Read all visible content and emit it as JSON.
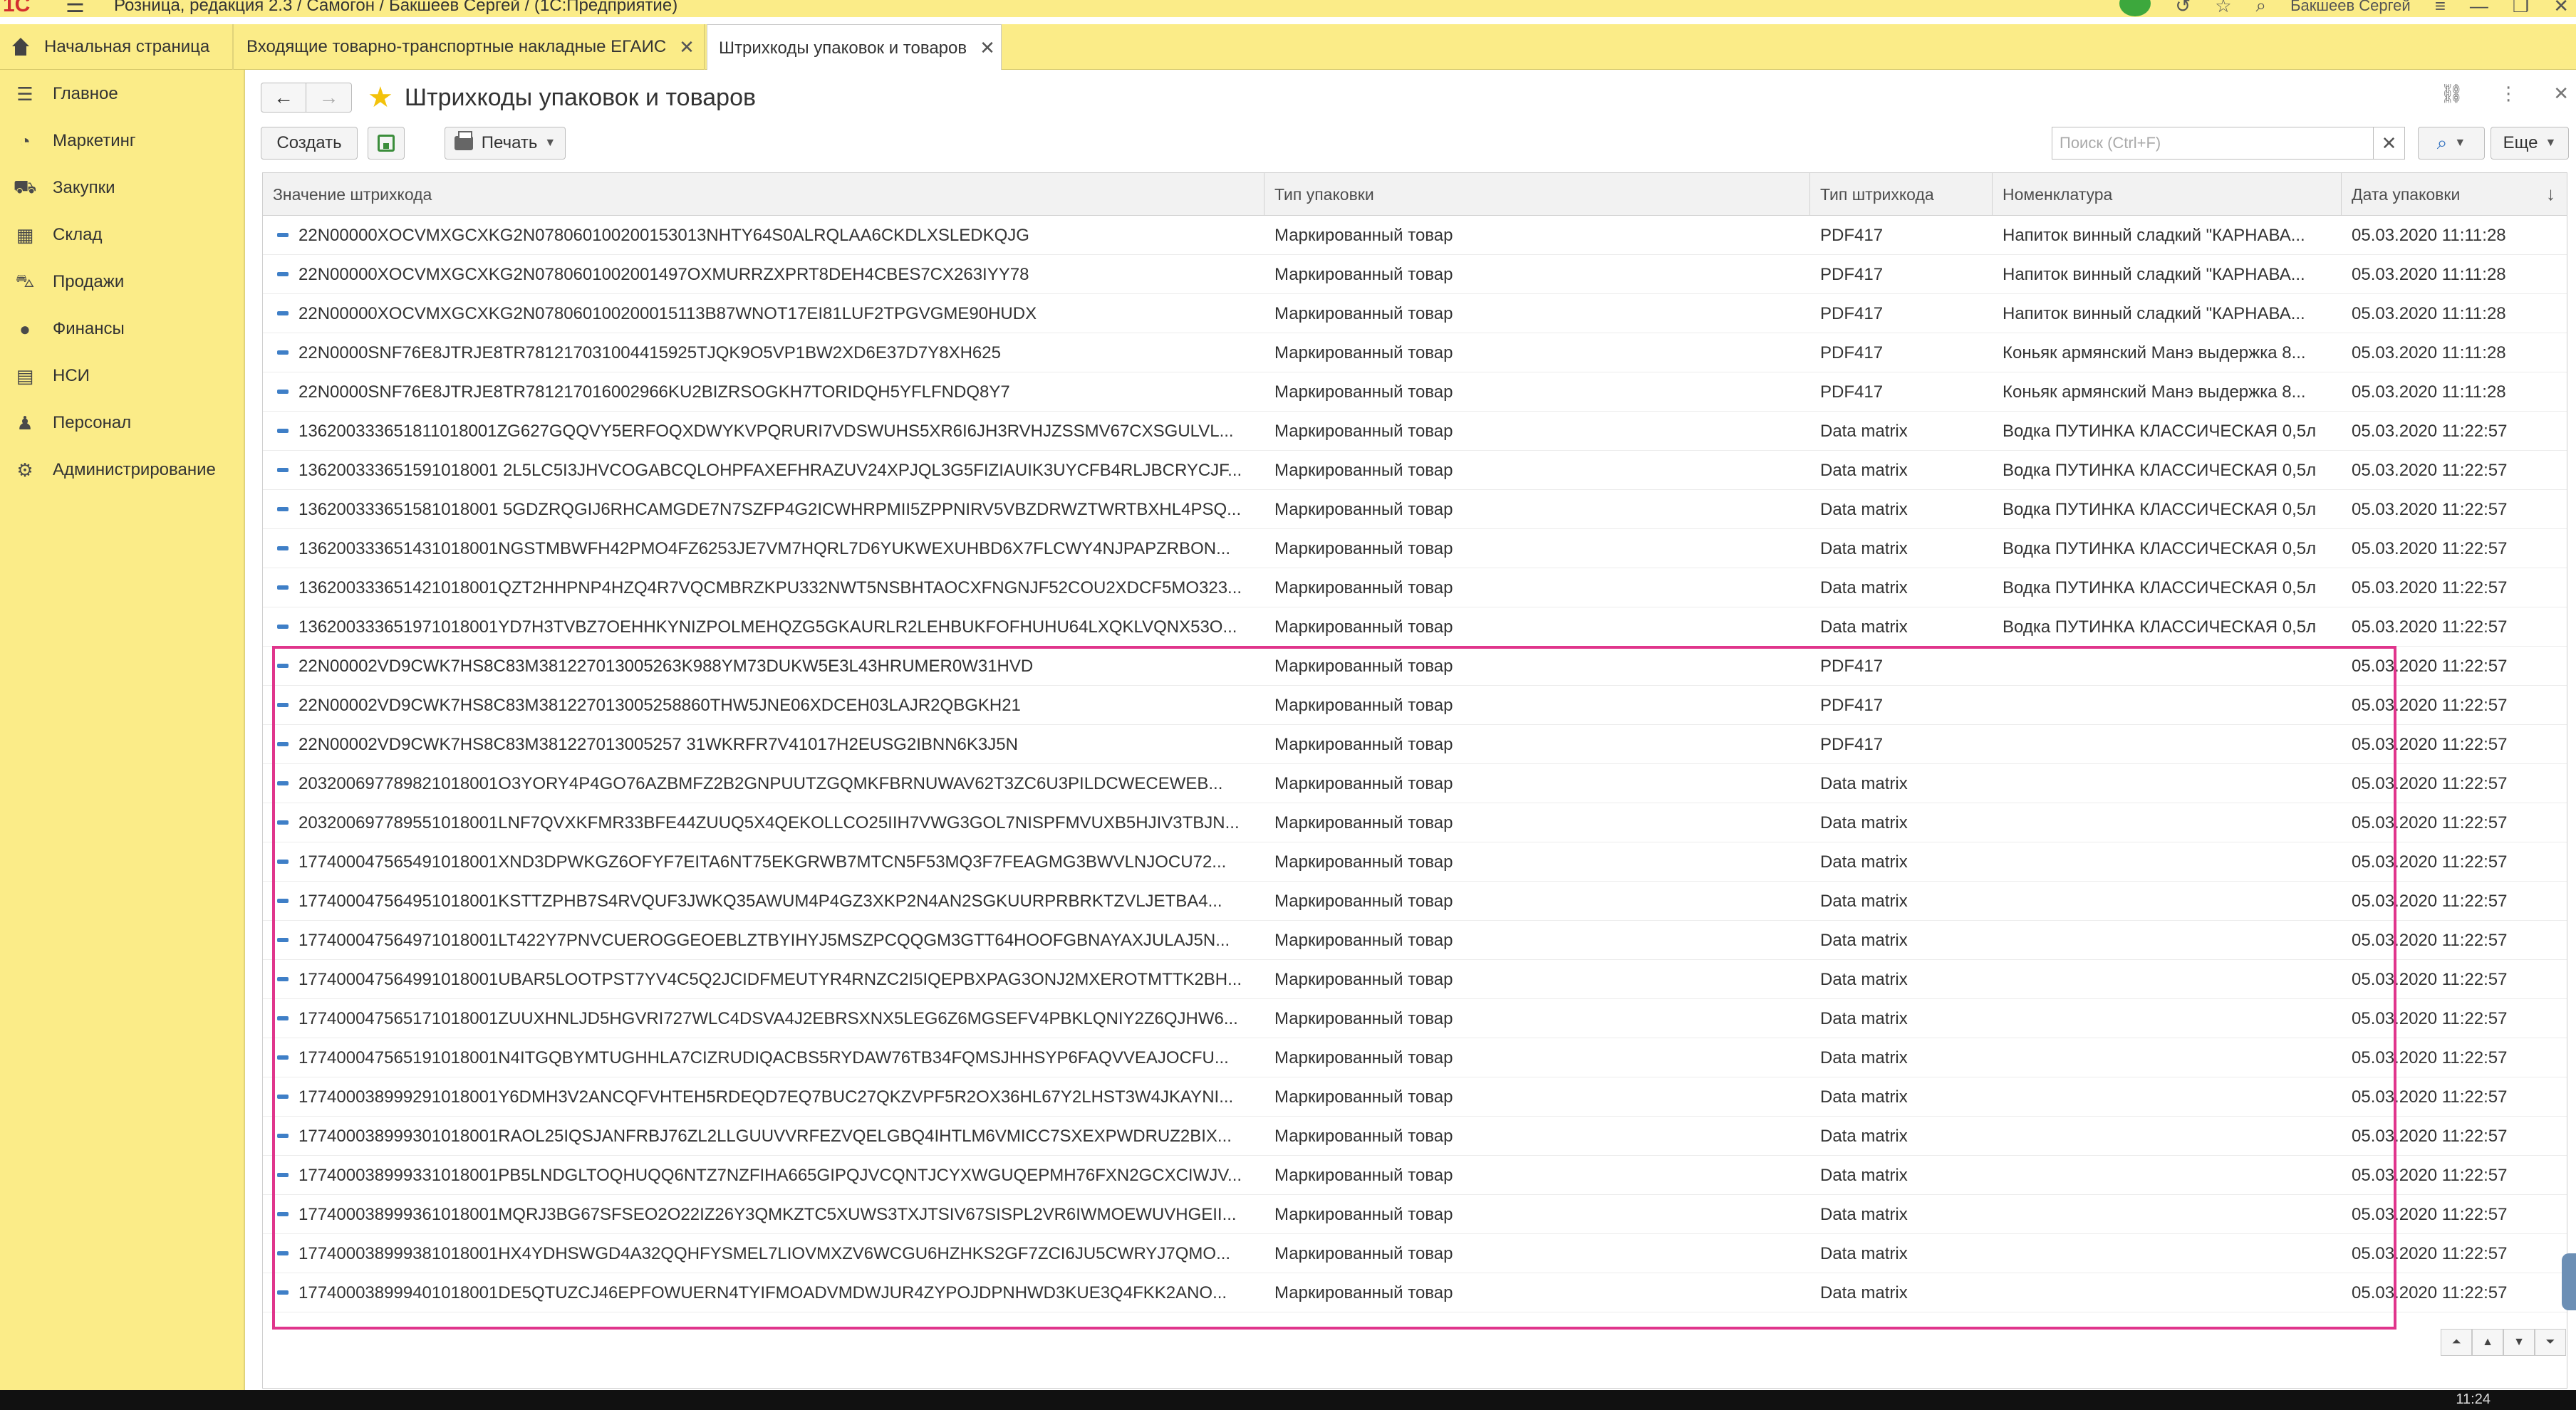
{
  "titlebar": {
    "app_title": "Розница, редакция 2.3 / Самогон / Бакшеев Сергей /  (1С:Предприятие)",
    "username": "Бакшеев Сергей"
  },
  "tabs": [
    {
      "label": "Начальная страница"
    },
    {
      "label": "Входящие товарно-транспортные накладные ЕГАИС"
    },
    {
      "label": "Штрихкоды упаковок и товаров"
    }
  ],
  "sidebar": {
    "items": [
      {
        "label": "Главное",
        "icon": "menu-icon"
      },
      {
        "label": "Маркетинг",
        "icon": "pie-chart-icon"
      },
      {
        "label": "Закупки",
        "icon": "truck-icon"
      },
      {
        "label": "Склад",
        "icon": "warehouse-icon"
      },
      {
        "label": "Продажи",
        "icon": "cart-icon"
      },
      {
        "label": "Финансы",
        "icon": "coin-icon"
      },
      {
        "label": "НСИ",
        "icon": "book-icon"
      },
      {
        "label": "Персонал",
        "icon": "person-icon"
      },
      {
        "label": "Администрирование",
        "icon": "gear-icon"
      }
    ]
  },
  "header": {
    "title": "Штрихкоды упаковок и товаров"
  },
  "toolbar": {
    "create_label": "Создать",
    "print_label": "Печать",
    "search_placeholder": "Поиск (Ctrl+F)",
    "more_label": "Еще"
  },
  "table": {
    "columns": [
      "Значение штрихкода",
      "Тип упаковки",
      "Тип штрихкода",
      "Номенклатура",
      "Дата упаковки"
    ],
    "rows": [
      {
        "barcode": "22N00000XOCVMXGCXKG2N078060100200153013NHTY64S0ALRQLAA6CKDLXSLEDKQJG",
        "pack_type": "Маркированный товар",
        "code_type": "PDF417",
        "item": "Напиток винный сладкий \"КАРНАВА...",
        "date": "05.03.2020 11:11:28"
      },
      {
        "barcode": "22N00000XOCVMXGCXKG2N0780601002001497OXMURRZXPRT8DEH4CBES7CX263IYY78",
        "pack_type": "Маркированный товар",
        "code_type": "PDF417",
        "item": "Напиток винный сладкий \"КАРНАВА...",
        "date": "05.03.2020 11:11:28"
      },
      {
        "barcode": "22N00000XOCVMXGCXKG2N078060100200015113B87WNOT17EI81LUF2TPGVGME90HUDX",
        "pack_type": "Маркированный товар",
        "code_type": "PDF417",
        "item": "Напиток винный сладкий \"КАРНАВА...",
        "date": "05.03.2020 11:11:28"
      },
      {
        "barcode": "22N0000SNF76E8JTRJE8TR781217031004415925TJQK9O5VP1BW2XD6E37D7Y8XH625",
        "pack_type": "Маркированный товар",
        "code_type": "PDF417",
        "item": "Коньяк армянский  Манэ выдержка 8...",
        "date": "05.03.2020 11:11:28"
      },
      {
        "barcode": "22N0000SNF76E8JTRJE8TR781217016002966KU2BIZRSOGKH7TORIDQH5YFLFNDQ8Y7",
        "pack_type": "Маркированный товар",
        "code_type": "PDF417",
        "item": "Коньяк армянский  Манэ выдержка 8...",
        "date": "05.03.2020 11:11:28"
      },
      {
        "barcode": "136200333651811018001ZG627GQQVY5ERFOQXDWYKVPQRURI7VDSWUHS5XR6I6JH3RVHJZSSMV67CXSGULVL...",
        "pack_type": "Маркированный товар",
        "code_type": "Data matrix",
        "item": "Водка ПУТИНКА КЛАССИЧЕСКАЯ 0,5л",
        "date": "05.03.2020 11:22:57"
      },
      {
        "barcode": "136200333651591018001 2L5LC5I3JHVCOGABCQLOHPFAXEFHRAZUV24XPJQL3G5FIZIAUIK3UYCFB4RLJBCRYCJF...",
        "pack_type": "Маркированный товар",
        "code_type": "Data matrix",
        "item": "Водка ПУТИНКА КЛАССИЧЕСКАЯ 0,5л",
        "date": "05.03.2020 11:22:57"
      },
      {
        "barcode": "136200333651581018001 5GDZRQGIJ6RHCAMGDE7N7SZFP4G2ICWHRPMII5ZPPNIRV5VBZDRWZTWRTBXHL4PSQ...",
        "pack_type": "Маркированный товар",
        "code_type": "Data matrix",
        "item": "Водка ПУТИНКА КЛАССИЧЕСКАЯ 0,5л",
        "date": "05.03.2020 11:22:57"
      },
      {
        "barcode": "136200333651431018001NGSTMBWFH42PMO4FZ6253JE7VM7HQRL7D6YUKWEXUHBD6X7FLCWY4NJPAPZRBON...",
        "pack_type": "Маркированный товар",
        "code_type": "Data matrix",
        "item": "Водка ПУТИНКА КЛАССИЧЕСКАЯ 0,5л",
        "date": "05.03.2020 11:22:57"
      },
      {
        "barcode": "136200333651421018001QZT2HHPNP4HZQ4R7VQCMBRZKPU332NWT5NSBHTAOCXFNGNJF52COU2XDCF5MO323...",
        "pack_type": "Маркированный товар",
        "code_type": "Data matrix",
        "item": "Водка ПУТИНКА КЛАССИЧЕСКАЯ 0,5л",
        "date": "05.03.2020 11:22:57"
      },
      {
        "barcode": "136200333651971018001YD7H3TVBZ7OEHHKYNIZPOLMEHQZG5GKAURLR2LEHBUKFOFHUHU64LXQKLVQNX53O...",
        "pack_type": "Маркированный товар",
        "code_type": "Data matrix",
        "item": "Водка ПУТИНКА КЛАССИЧЕСКАЯ 0,5л",
        "date": "05.03.2020 11:22:57"
      },
      {
        "barcode": "22N00002VD9CWK7HS8C83M381227013005263K988YM73DUKW5E3L43HRUMER0W31HVD",
        "pack_type": "Маркированный товар",
        "code_type": "PDF417",
        "item": "",
        "date": "05.03.2020 11:22:57"
      },
      {
        "barcode": "22N00002VD9CWK7HS8C83M381227013005258860THW5JNE06XDCEH03LAJR2QBGKH21",
        "pack_type": "Маркированный товар",
        "code_type": "PDF417",
        "item": "",
        "date": "05.03.2020 11:22:57"
      },
      {
        "barcode": "22N00002VD9CWK7HS8C83M381227013005257 31WKRFR7V41017H2EUSG2IBNN6K3J5N",
        "pack_type": "Маркированный товар",
        "code_type": "PDF417",
        "item": "",
        "date": "05.03.2020 11:22:57"
      },
      {
        "barcode": "203200697789821018001O3YORY4P4GO76AZBMFZ2B2GNPUUTZGQMKFBRNUWAV62T3ZC6U3PILDCWECEWEB...",
        "pack_type": "Маркированный товар",
        "code_type": "Data matrix",
        "item": "",
        "date": "05.03.2020 11:22:57"
      },
      {
        "barcode": "203200697789551018001LNF7QVXKFMR33BFE44ZUUQ5X4QEKOLLCO25IIH7VWG3GOL7NISPFMVUXB5HJIV3TBJN...",
        "pack_type": "Маркированный товар",
        "code_type": "Data matrix",
        "item": "",
        "date": "05.03.2020 11:22:57"
      },
      {
        "barcode": "177400047565491018001XND3DPWKGZ6OFYF7EITA6NT75EKGRWB7MTCN5F53MQ3F7FEAGMG3BWVLNJOCU72...",
        "pack_type": "Маркированный товар",
        "code_type": "Data matrix",
        "item": "",
        "date": "05.03.2020 11:22:57"
      },
      {
        "barcode": "177400047564951018001KSTTZPHB7S4RVQUF3JWKQ35AWUM4P4GZ3XKP2N4AN2SGKUURPRBRKTZVLJETBA4...",
        "pack_type": "Маркированный товар",
        "code_type": "Data matrix",
        "item": "",
        "date": "05.03.2020 11:22:57"
      },
      {
        "barcode": "177400047564971018001LT422Y7PNVCUEROGGEOEBLZTBYIHYJ5MSZPCQQGM3GTT64HOOFGBNAYAXJULAJ5N...",
        "pack_type": "Маркированный товар",
        "code_type": "Data matrix",
        "item": "",
        "date": "05.03.2020 11:22:57"
      },
      {
        "barcode": "177400047564991018001UBAR5LOOTPST7YV4C5Q2JCIDFMEUTYR4RNZC2I5IQEPBXPAG3ONJ2MXEROTMTTK2BH...",
        "pack_type": "Маркированный товар",
        "code_type": "Data matrix",
        "item": "",
        "date": "05.03.2020 11:22:57"
      },
      {
        "barcode": "177400047565171018001ZUUXHNLJD5HGVRI727WLC4DSVA4J2EBRSXNX5LEG6Z6MGSEFV4PBKLQNIY2Z6QJHW6...",
        "pack_type": "Маркированный товар",
        "code_type": "Data matrix",
        "item": "",
        "date": "05.03.2020 11:22:57"
      },
      {
        "barcode": "177400047565191018001N4ITGQBYMTUGHHLA7CIZRUDIQACBS5RYDAW76TB34FQMSJHHSYP6FAQVVEAJOCFU...",
        "pack_type": "Маркированный товар",
        "code_type": "Data matrix",
        "item": "",
        "date": "05.03.2020 11:22:57"
      },
      {
        "barcode": "177400038999291018001Y6DMH3V2ANCQFVHTEH5RDEQD7EQ7BUC27QKZVPF5R2OX36HL67Y2LHST3W4JKAYNI...",
        "pack_type": "Маркированный товар",
        "code_type": "Data matrix",
        "item": "",
        "date": "05.03.2020 11:22:57"
      },
      {
        "barcode": "177400038999301018001RAOL25IQSJANFRBJ76ZL2LLGUUVVRFEZVQELGBQ4IHTLM6VMICC7SXEXPWDRUZ2BIX...",
        "pack_type": "Маркированный товар",
        "code_type": "Data matrix",
        "item": "",
        "date": "05.03.2020 11:22:57"
      },
      {
        "barcode": "177400038999331018001PB5LNDGLTOQHUQQ6NTZ7NZFIHA665GIPQJVCQNTJCYXWGUQEPMH76FXN2GCXCIWJV...",
        "pack_type": "Маркированный товар",
        "code_type": "Data matrix",
        "item": "",
        "date": "05.03.2020 11:22:57"
      },
      {
        "barcode": "177400038999361018001MQRJ3BG67SFSEO2O22IZ26Y3QMKZTC5XUWS3TXJTSIV67SISPL2VR6IWMOEWUVHGEII...",
        "pack_type": "Маркированный товар",
        "code_type": "Data matrix",
        "item": "",
        "date": "05.03.2020 11:22:57"
      },
      {
        "barcode": "177400038999381018001HX4YDHSWGD4A32QQHFYSMEL7LIOVMXZV6WCGU6HZHKS2GF7ZCI6JU5CWRYJ7QMO...",
        "pack_type": "Маркированный товар",
        "code_type": "Data matrix",
        "item": "",
        "date": "05.03.2020 11:22:57"
      },
      {
        "barcode": "177400038999401018001DE5QTUZCJ46EPFOWUERN4TYIFMOADVMDWJUR4ZYPOJDPNHWD3KUE3Q4FKK2ANO...",
        "pack_type": "Маркированный товар",
        "code_type": "Data matrix",
        "item": "",
        "date": "05.03.2020 11:22:57"
      }
    ]
  },
  "taskbar": {
    "clock": "11:24"
  },
  "colors": {
    "panel_yellow": "#fbec88",
    "highlight_pink": "#e0358c",
    "accent_blue": "#3f7fc7"
  }
}
